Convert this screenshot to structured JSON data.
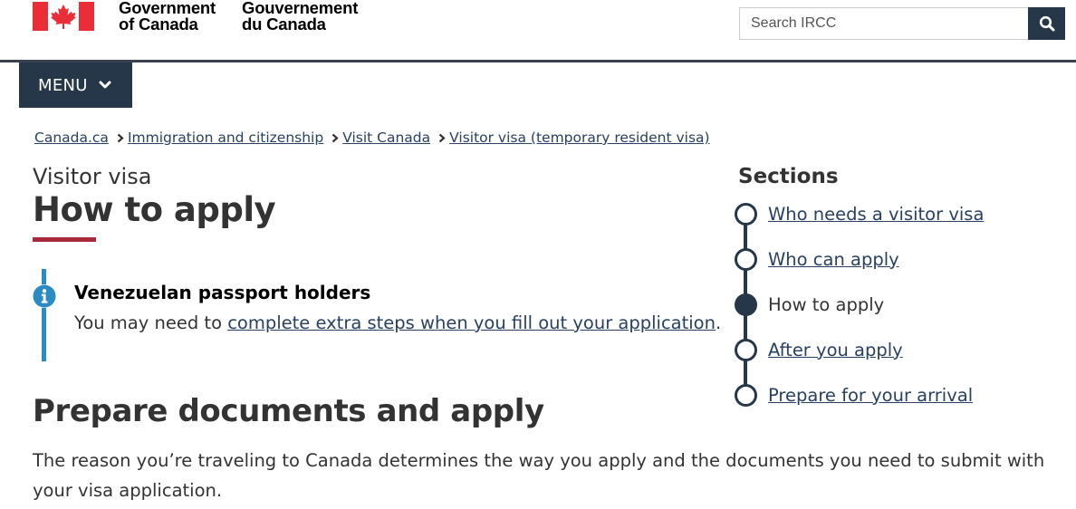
{
  "header": {
    "signature_en": [
      "Government",
      "of Canada"
    ],
    "signature_fr": [
      "Gouvernement",
      "du Canada"
    ],
    "flag_colors": {
      "red": "#eb2d37",
      "white": "#ffffff"
    },
    "search": {
      "placeholder": "Search IRCC",
      "button_icon": "search-icon"
    }
  },
  "menu": {
    "label": "MENU",
    "icon": "chevron-down-icon"
  },
  "breadcrumb": [
    "Canada.ca",
    "Immigration and citizenship",
    "Visit Canada",
    "Visitor visa (temporary resident visa)"
  ],
  "page": {
    "kicker": "Visitor visa",
    "title": "How to apply"
  },
  "alert": {
    "icon": "info-icon",
    "title": "Venezuelan passport holders",
    "text_before": "You may need to ",
    "link_text": "complete extra steps when you fill out your application",
    "text_after": "."
  },
  "section": {
    "heading": "Prepare documents and apply",
    "paragraph": "The reason you’re traveling to Canada determines the way you apply and the documents you need to submit with your visa application."
  },
  "sections_nav": {
    "heading": "Sections",
    "items": [
      {
        "label": "Who needs a visitor visa",
        "current": false
      },
      {
        "label": "Who can apply",
        "current": false
      },
      {
        "label": "How to apply",
        "current": true
      },
      {
        "label": "After you apply",
        "current": false
      },
      {
        "label": "Prepare for your arrival",
        "current": false
      }
    ]
  },
  "colors": {
    "nav_dark": "#26374a",
    "link": "#284162",
    "title_accent": "#a62a3a",
    "alert_info": "#2b8cc4"
  }
}
